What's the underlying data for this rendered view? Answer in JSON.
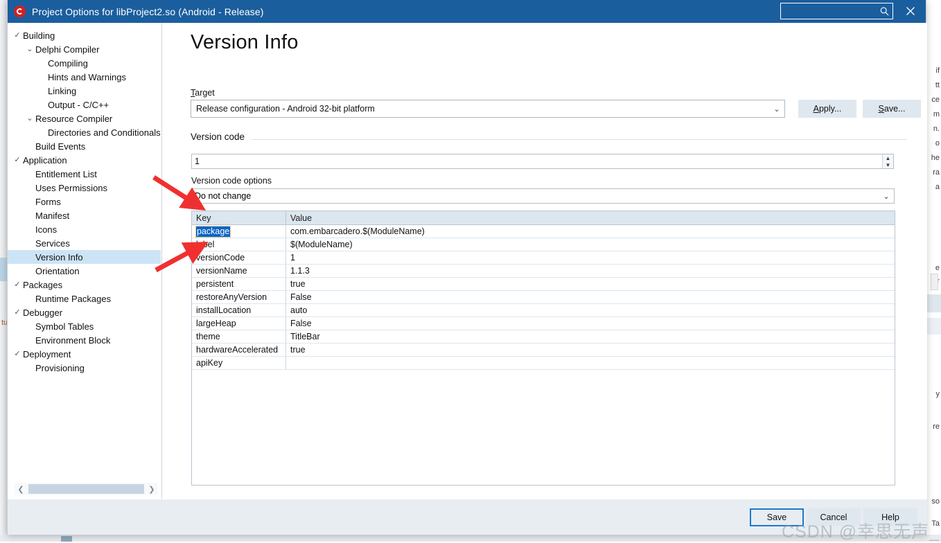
{
  "window": {
    "title": "Project Options for libProject2.so  (Android - Release)",
    "app_icon": "embarcadero-logo-icon",
    "search_placeholder": "",
    "search_value": "",
    "search_icon": "search-icon",
    "close_icon": "close-icon",
    "accent_color": "#1b5e9e"
  },
  "sidebar": {
    "items": [
      {
        "label": "Building",
        "mark": "check",
        "indent": 0,
        "selected": false
      },
      {
        "label": "Delphi Compiler",
        "mark": "chevron-down",
        "indent": 1,
        "selected": false
      },
      {
        "label": "Compiling",
        "mark": "none",
        "indent": 2,
        "selected": false
      },
      {
        "label": "Hints and Warnings",
        "mark": "none",
        "indent": 2,
        "selected": false
      },
      {
        "label": "Linking",
        "mark": "none",
        "indent": 2,
        "selected": false
      },
      {
        "label": "Output - C/C++",
        "mark": "none",
        "indent": 2,
        "selected": false
      },
      {
        "label": "Resource Compiler",
        "mark": "chevron-down",
        "indent": 1,
        "selected": false
      },
      {
        "label": "Directories and Conditionals",
        "mark": "none",
        "indent": 2,
        "selected": false
      },
      {
        "label": "Build Events",
        "mark": "none",
        "indent": 1,
        "selected": false
      },
      {
        "label": "Application",
        "mark": "check",
        "indent": 0,
        "selected": false
      },
      {
        "label": "Entitlement List",
        "mark": "none",
        "indent": 1,
        "selected": false
      },
      {
        "label": "Uses Permissions",
        "mark": "none",
        "indent": 1,
        "selected": false
      },
      {
        "label": "Forms",
        "mark": "none",
        "indent": 1,
        "selected": false
      },
      {
        "label": "Manifest",
        "mark": "none",
        "indent": 1,
        "selected": false
      },
      {
        "label": "Icons",
        "mark": "none",
        "indent": 1,
        "selected": false
      },
      {
        "label": "Services",
        "mark": "none",
        "indent": 1,
        "selected": false
      },
      {
        "label": "Version Info",
        "mark": "none",
        "indent": 1,
        "selected": true
      },
      {
        "label": "Orientation",
        "mark": "none",
        "indent": 1,
        "selected": false
      },
      {
        "label": "Packages",
        "mark": "check",
        "indent": 0,
        "selected": false
      },
      {
        "label": "Runtime Packages",
        "mark": "none",
        "indent": 1,
        "selected": false
      },
      {
        "label": "Debugger",
        "mark": "check",
        "indent": 0,
        "selected": false
      },
      {
        "label": "Symbol Tables",
        "mark": "none",
        "indent": 1,
        "selected": false
      },
      {
        "label": "Environment Block",
        "mark": "none",
        "indent": 1,
        "selected": false
      },
      {
        "label": "Deployment",
        "mark": "check",
        "indent": 0,
        "selected": false
      },
      {
        "label": "Provisioning",
        "mark": "none",
        "indent": 1,
        "selected": false
      }
    ],
    "scroll_left_icon": "chevron-left-icon",
    "scroll_right_icon": "chevron-right-icon"
  },
  "main": {
    "page_title": "Version Info",
    "target": {
      "label_prefix": "T",
      "label_rest": "arget",
      "value": "Release configuration - Android 32-bit platform",
      "dropdown_icon": "chevron-down-icon"
    },
    "apply_button": {
      "prefix": "A",
      "rest": "pply..."
    },
    "save_top_button": {
      "prefix": "S",
      "rest": "ave..."
    },
    "version_code_group": {
      "legend": "Version code",
      "value": "1",
      "spin_up_icon": "caret-up-icon",
      "spin_down_icon": "caret-down-icon",
      "options_label": "Version code options",
      "options_value": "Do not change",
      "options_dropdown_icon": "chevron-down-icon"
    },
    "grid": {
      "columns": [
        "Key",
        "Value"
      ],
      "rows": [
        {
          "key": "package",
          "value": "com.embarcadero.$(ModuleName)",
          "selected": true
        },
        {
          "key": "label",
          "value": "$(ModuleName)",
          "selected": false
        },
        {
          "key": "versionCode",
          "value": "1",
          "selected": false
        },
        {
          "key": "versionName",
          "value": "1.1.3",
          "selected": false
        },
        {
          "key": "persistent",
          "value": "true",
          "selected": false
        },
        {
          "key": "restoreAnyVersion",
          "value": "False",
          "selected": false
        },
        {
          "key": "installLocation",
          "value": "auto",
          "selected": false
        },
        {
          "key": "largeHeap",
          "value": "False",
          "selected": false
        },
        {
          "key": "theme",
          "value": "TitleBar",
          "selected": false
        },
        {
          "key": "hardwareAccelerated",
          "value": "true",
          "selected": false
        },
        {
          "key": "apiKey",
          "value": "",
          "selected": false
        }
      ]
    }
  },
  "footer": {
    "save": "Save",
    "cancel": "Cancel",
    "help": "Help"
  },
  "annotations": {
    "arrow_color": "#f03030",
    "watermark": "CSDN @幸思无声_东莞"
  },
  "background_window": {
    "right_fragments": [
      "if",
      "tt",
      "ce",
      "m",
      "n.",
      "o",
      "he",
      "ra",
      "a",
      "e",
      "tr",
      "y",
      "re",
      "so",
      "Ta"
    ],
    "left_fragment": "tu"
  }
}
